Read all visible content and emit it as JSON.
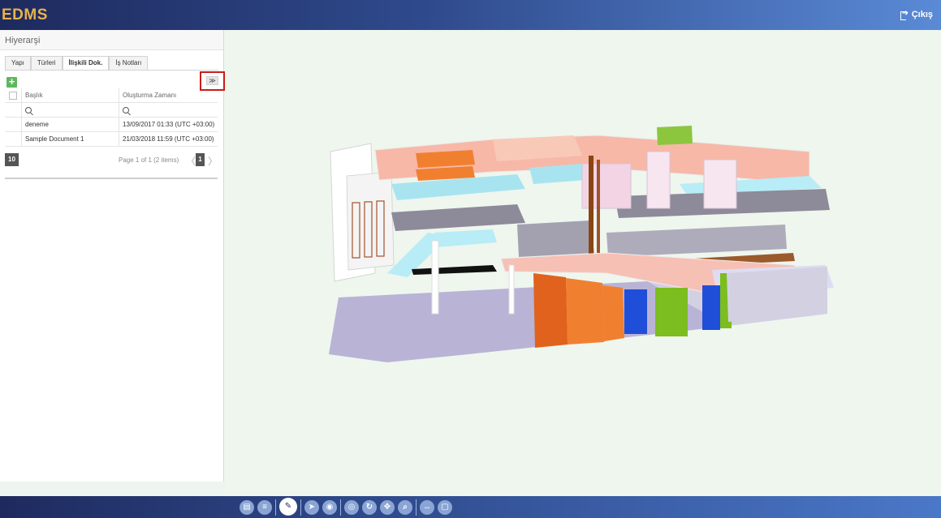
{
  "app": {
    "logo": "EDMS",
    "logout_label": "Çıkış"
  },
  "panel": {
    "title": "Hiyerarşi",
    "tabs": [
      {
        "label": "Yapı",
        "active": false
      },
      {
        "label": "Türleri",
        "active": false
      },
      {
        "label": "İlişkili Dok.",
        "active": true
      },
      {
        "label": "İş Notları",
        "active": false
      }
    ],
    "add_label": "+",
    "expand_label": "≫",
    "table": {
      "columns": [
        "Başlık",
        "Oluşturma Zamanı"
      ],
      "rows": [
        {
          "title": "deneme",
          "created": "13/09/2017 01:33 (UTC +03:00)"
        },
        {
          "title": "Sample Document 1",
          "created": "21/03/2018 11:59 (UTC +03:00)"
        }
      ]
    },
    "pager": {
      "page_size": "10",
      "info": "Page 1 of 1 (2 items)",
      "current_page": "1",
      "prev": "〈",
      "next": "〉"
    }
  },
  "toolbar": {
    "buttons": [
      {
        "name": "model-browser-icon",
        "glyph": "▤",
        "active": false
      },
      {
        "name": "list-icon",
        "glyph": "≡",
        "active": false
      },
      {
        "name": "paint-brush-icon",
        "glyph": "✎",
        "active": true
      },
      {
        "name": "select-pointer-icon",
        "glyph": "➤",
        "active": false
      },
      {
        "name": "orbit-target-icon",
        "glyph": "◉",
        "active": false
      },
      {
        "name": "eye-icon",
        "glyph": "◎",
        "active": false
      },
      {
        "name": "rotate-icon",
        "glyph": "↻",
        "active": false
      },
      {
        "name": "pan-icon",
        "glyph": "✥",
        "active": false
      },
      {
        "name": "zoom-icon",
        "glyph": "⌕",
        "active": false
      },
      {
        "name": "measure-icon",
        "glyph": "↔",
        "active": false
      },
      {
        "name": "section-box-icon",
        "glyph": "▢",
        "active": false
      }
    ]
  }
}
